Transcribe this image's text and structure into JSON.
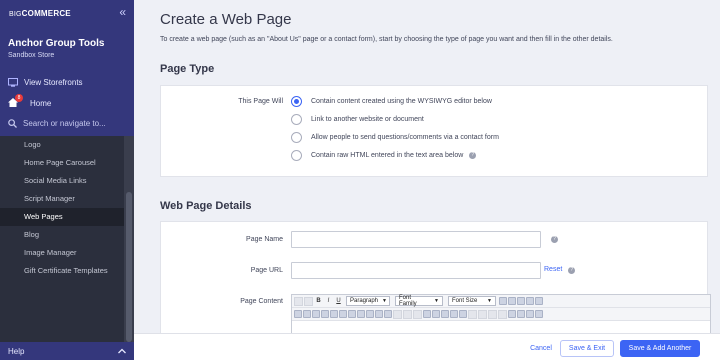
{
  "sidebar": {
    "logo_prefix": "BIG",
    "logo_text": "COMMERCE",
    "store_name": "Anchor Group Tools",
    "store_subtitle": "Sandbox Store",
    "view_storefront": "View Storefronts",
    "home": "Home",
    "home_badge": "8",
    "search_placeholder": "Search or navigate to...",
    "items": [
      {
        "label": "Logo"
      },
      {
        "label": "Home Page Carousel"
      },
      {
        "label": "Social Media Links"
      },
      {
        "label": "Script Manager"
      },
      {
        "label": "Web Pages"
      },
      {
        "label": "Blog"
      },
      {
        "label": "Image Manager"
      },
      {
        "label": "Gift Certificate Templates"
      }
    ],
    "active_item": "Web Pages",
    "help": "Help"
  },
  "main": {
    "title": "Create a Web Page",
    "intro": "To create a web page (such as an \"About Us\" page or a contact form), start by choosing the type of page you want and then fill in the other details.",
    "page_type": {
      "heading": "Page Type",
      "label": "This Page Will",
      "options": [
        {
          "label": "Contain content created using the WYSIWYG editor below",
          "checked": true
        },
        {
          "label": "Link to another website or document",
          "checked": false
        },
        {
          "label": "Allow people to send questions/comments via a contact form",
          "checked": false
        },
        {
          "label": "Contain raw HTML entered in the text area below",
          "checked": false
        }
      ],
      "help_glyph": "?"
    },
    "details": {
      "heading": "Web Page Details",
      "page_name_label": "Page Name",
      "page_name_value": "",
      "page_url_label": "Page URL",
      "page_url_value": "",
      "reset": "Reset",
      "content_label": "Page Content",
      "editor": {
        "format_select": "Paragraph",
        "font_family_select": "Font Family",
        "font_size_select": "Font Size",
        "bold": "B",
        "italic": "I",
        "underline": "U"
      }
    }
  },
  "footer": {
    "cancel": "Cancel",
    "save_exit": "Save & Exit",
    "save_add": "Save & Add Another"
  },
  "colors": {
    "sidebar_brand": "#34377c",
    "sidebar_dark": "#2b2f3d",
    "accent": "#3c64f4"
  }
}
